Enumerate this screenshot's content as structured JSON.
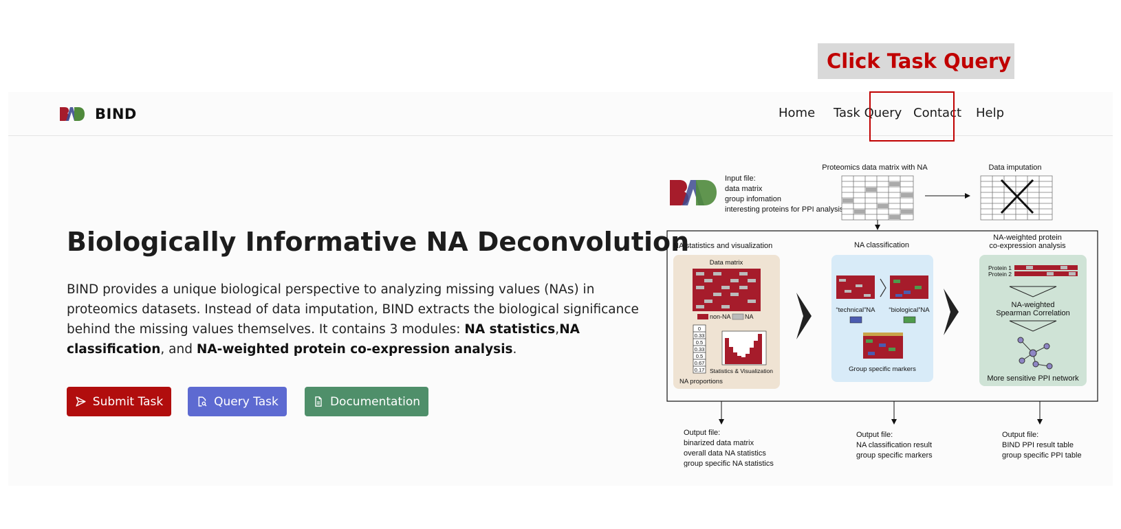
{
  "callout": {
    "text": "Click Task Query"
  },
  "brand": {
    "name": "BIND"
  },
  "nav": {
    "items": [
      {
        "label": "Home"
      },
      {
        "label": "Task Query"
      },
      {
        "label": "Contact"
      },
      {
        "label": "Help"
      }
    ]
  },
  "hero": {
    "title": "Biologically Informative NA Deconvolution",
    "desc_intro": "BIND provides a unique biological perspective to analyzing missing values (NAs) in proteomics datasets. Instead of data imputation, BIND extracts the biological significance behind the missing values themselves. It contains 3 modules: ",
    "module_1": "NA statistics",
    "sep_1": ",",
    "module_2": "NA classification",
    "sep_2": ", and ",
    "module_3": "NA-weighted protein co-expression analysis",
    "desc_end": "."
  },
  "buttons": {
    "submit": "Submit Task",
    "query": "Query Task",
    "docs": "Documentation"
  },
  "diagram": {
    "input_file_label": "Input file:",
    "input_items": [
      "data matrix",
      "group infomation",
      "interesting proteins for PPI analysis"
    ],
    "matrix_title": "Proteomics data matrix with NA",
    "imputation_title": "Data imputation",
    "module1_title": "NA statistics and visualization",
    "module1_data_matrix": "Data matrix",
    "legend_non_na": "non-NA",
    "legend_na": "NA",
    "proportions": [
      "0",
      "0.33",
      "0.5",
      "0.33",
      "0.5",
      "0.67",
      "0.17"
    ],
    "proportions_label": "NA proportions",
    "stats_label": "Statistics & Visualization",
    "module2_title": "NA classification",
    "technical_label": "“technical”NA",
    "biological_label": "“biological”NA",
    "markers_label": "Group specific markers",
    "module3_title_1": "NA-weighted protein",
    "module3_title_2": "co-expression analysis",
    "protein_1": "Protein 1",
    "protein_2": "Protein 2",
    "spearman_1": "NA-weighted",
    "spearman_2": "Spearman Correlation",
    "ppi_label": "More sensitive PPI network",
    "output_label": "Output file:",
    "output_1": [
      "binarized data matrix",
      "overall data NA statistics",
      "group specific NA statistics"
    ],
    "output_2": [
      "NA classification result",
      "group specific markers"
    ],
    "output_3": [
      "BIND PPI result table",
      "group specific PPI table"
    ]
  },
  "colors": {
    "callout_text": "#c00000",
    "highlight": "#c00000",
    "submit": "#b10d0d",
    "query": "#5d6ad1",
    "docs": "#4f8f6a"
  }
}
